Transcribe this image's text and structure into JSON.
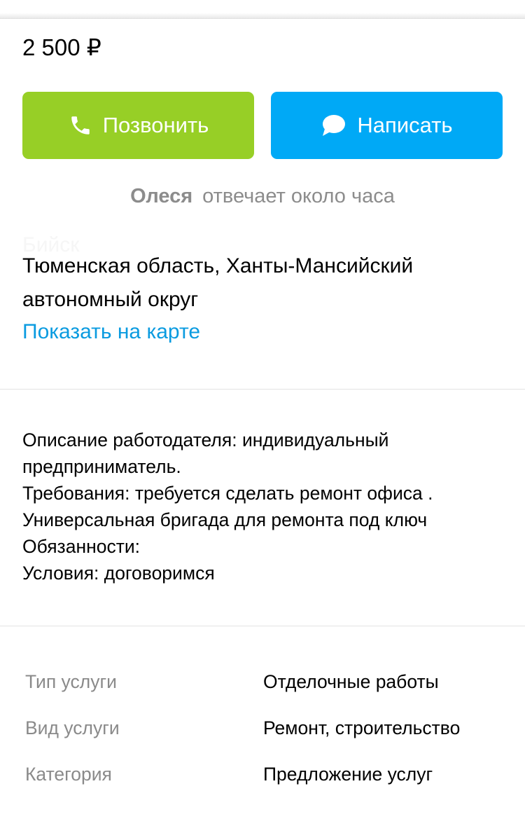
{
  "price": "2 500 ₽",
  "buttons": {
    "call_label": "Позвонить",
    "write_label": "Написать",
    "call_color": "#97cf26",
    "write_color": "#00a9f6"
  },
  "seller": {
    "name": "Олеся",
    "response": "отвечает около часа"
  },
  "location": {
    "ghost_text": "Бийск",
    "address": "Тюменская область, Ханты-Мансийский автономный округ",
    "map_link": "Показать на карте"
  },
  "description": {
    "lines": [
      "Описание работодателя: индивидуальный предприниматель.",
      "Требования: требуется сделать ремонт офиса .",
      "Универсальная бригада для ремонта под ключ",
      "Обязанности:",
      "Условия: договоримся"
    ]
  },
  "params": [
    {
      "label": "Тип услуги",
      "value": "Отделочные работы"
    },
    {
      "label": "Вид услуги",
      "value": "Ремонт, строительство"
    },
    {
      "label": "Категория",
      "value": "Предложение услуг"
    }
  ],
  "icons": {
    "call": "phone-icon",
    "write": "chat-bubble-icon"
  }
}
